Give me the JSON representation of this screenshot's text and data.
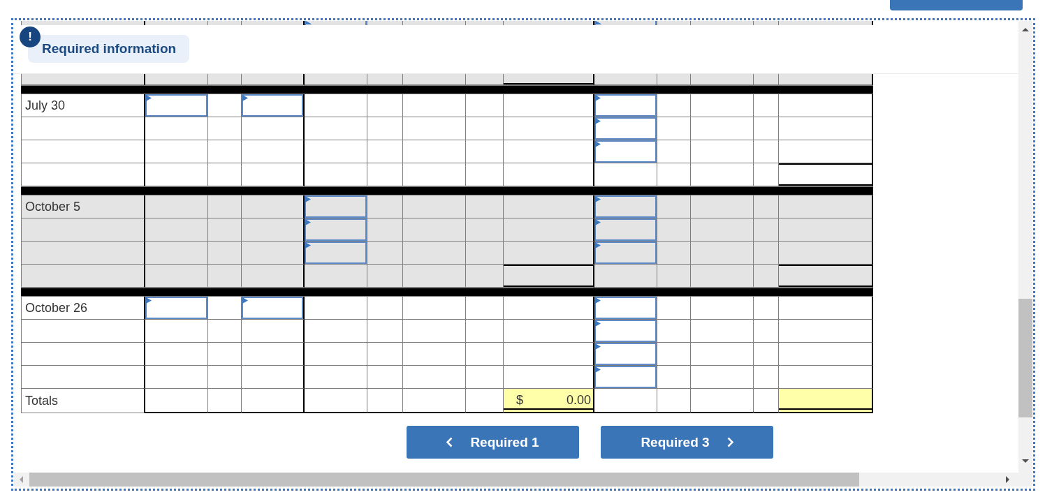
{
  "cut_row": {
    "shaded": true,
    "cells": [
      {
        "kind": "blank"
      },
      {
        "kind": "blank"
      },
      {
        "kind": "blank"
      },
      {
        "kind": "input"
      },
      {
        "kind": "blank"
      },
      {
        "kind": "blank"
      },
      {
        "kind": "blank"
      },
      {
        "kind": "blank"
      },
      {
        "kind": "input"
      },
      {
        "kind": "blank"
      },
      {
        "kind": "blank"
      },
      {
        "kind": "blank"
      },
      {
        "kind": "blank"
      }
    ]
  },
  "notice": {
    "icon": "!",
    "label": "Required information"
  },
  "table": {
    "sections": [
      {
        "shaded": true,
        "clipped": true,
        "rows": [
          {
            "cells": [
              {
                "kind": "blank"
              },
              {
                "kind": "blank"
              },
              {
                "kind": "blank"
              },
              {
                "kind": "blank"
              },
              {
                "kind": "blank"
              },
              {
                "kind": "blank"
              },
              {
                "kind": "blank"
              },
              {
                "kind": "rule"
              },
              {
                "kind": "blank"
              },
              {
                "kind": "blank"
              },
              {
                "kind": "blank"
              },
              {
                "kind": "blank"
              },
              {
                "kind": "blank"
              }
            ]
          }
        ]
      },
      {
        "shaded": false,
        "clipped": false,
        "rows": [
          {
            "label": "July 30",
            "cells": [
              {
                "kind": "input"
              },
              {
                "kind": "blank"
              },
              {
                "kind": "input"
              },
              {
                "kind": "blank"
              },
              {
                "kind": "blank"
              },
              {
                "kind": "blank"
              },
              {
                "kind": "blank"
              },
              {
                "kind": "blank"
              },
              {
                "kind": "input"
              },
              {
                "kind": "blank"
              },
              {
                "kind": "blank"
              },
              {
                "kind": "blank"
              },
              {
                "kind": "blank"
              }
            ]
          },
          {
            "cells": [
              {
                "kind": "blank"
              },
              {
                "kind": "blank"
              },
              {
                "kind": "blank"
              },
              {
                "kind": "blank"
              },
              {
                "kind": "blank"
              },
              {
                "kind": "blank"
              },
              {
                "kind": "blank"
              },
              {
                "kind": "blank"
              },
              {
                "kind": "input"
              },
              {
                "kind": "blank"
              },
              {
                "kind": "blank"
              },
              {
                "kind": "blank"
              },
              {
                "kind": "blank"
              }
            ]
          },
          {
            "cells": [
              {
                "kind": "blank"
              },
              {
                "kind": "blank"
              },
              {
                "kind": "blank"
              },
              {
                "kind": "blank"
              },
              {
                "kind": "blank"
              },
              {
                "kind": "blank"
              },
              {
                "kind": "blank"
              },
              {
                "kind": "blank"
              },
              {
                "kind": "input"
              },
              {
                "kind": "blank"
              },
              {
                "kind": "blank"
              },
              {
                "kind": "blank"
              },
              {
                "kind": "blank"
              }
            ]
          },
          {
            "cells": [
              {
                "kind": "blank"
              },
              {
                "kind": "blank"
              },
              {
                "kind": "blank"
              },
              {
                "kind": "blank"
              },
              {
                "kind": "blank"
              },
              {
                "kind": "blank"
              },
              {
                "kind": "blank"
              },
              {
                "kind": "blank"
              },
              {
                "kind": "blank"
              },
              {
                "kind": "blank"
              },
              {
                "kind": "blank"
              },
              {
                "kind": "blank"
              },
              {
                "kind": "rule"
              }
            ]
          }
        ]
      },
      {
        "shaded": true,
        "clipped": false,
        "rows": [
          {
            "label": "October 5",
            "cells": [
              {
                "kind": "blank"
              },
              {
                "kind": "blank"
              },
              {
                "kind": "blank"
              },
              {
                "kind": "input"
              },
              {
                "kind": "blank"
              },
              {
                "kind": "blank"
              },
              {
                "kind": "blank"
              },
              {
                "kind": "blank"
              },
              {
                "kind": "input"
              },
              {
                "kind": "blank"
              },
              {
                "kind": "blank"
              },
              {
                "kind": "blank"
              },
              {
                "kind": "blank"
              }
            ]
          },
          {
            "cells": [
              {
                "kind": "blank"
              },
              {
                "kind": "blank"
              },
              {
                "kind": "blank"
              },
              {
                "kind": "input"
              },
              {
                "kind": "blank"
              },
              {
                "kind": "blank"
              },
              {
                "kind": "blank"
              },
              {
                "kind": "blank"
              },
              {
                "kind": "input"
              },
              {
                "kind": "blank"
              },
              {
                "kind": "blank"
              },
              {
                "kind": "blank"
              },
              {
                "kind": "blank"
              }
            ]
          },
          {
            "cells": [
              {
                "kind": "blank"
              },
              {
                "kind": "blank"
              },
              {
                "kind": "blank"
              },
              {
                "kind": "input"
              },
              {
                "kind": "blank"
              },
              {
                "kind": "blank"
              },
              {
                "kind": "blank"
              },
              {
                "kind": "blank"
              },
              {
                "kind": "input"
              },
              {
                "kind": "blank"
              },
              {
                "kind": "blank"
              },
              {
                "kind": "blank"
              },
              {
                "kind": "blank"
              }
            ]
          },
          {
            "cells": [
              {
                "kind": "blank"
              },
              {
                "kind": "blank"
              },
              {
                "kind": "blank"
              },
              {
                "kind": "blank"
              },
              {
                "kind": "blank"
              },
              {
                "kind": "blank"
              },
              {
                "kind": "blank"
              },
              {
                "kind": "rule"
              },
              {
                "kind": "blank"
              },
              {
                "kind": "blank"
              },
              {
                "kind": "blank"
              },
              {
                "kind": "blank"
              },
              {
                "kind": "rule"
              }
            ]
          }
        ]
      },
      {
        "shaded": false,
        "clipped": false,
        "rows": [
          {
            "label": "October 26",
            "cells": [
              {
                "kind": "input"
              },
              {
                "kind": "blank"
              },
              {
                "kind": "input"
              },
              {
                "kind": "blank"
              },
              {
                "kind": "blank"
              },
              {
                "kind": "blank"
              },
              {
                "kind": "blank"
              },
              {
                "kind": "blank"
              },
              {
                "kind": "input"
              },
              {
                "kind": "blank"
              },
              {
                "kind": "blank"
              },
              {
                "kind": "blank"
              },
              {
                "kind": "blank"
              }
            ]
          },
          {
            "cells": [
              {
                "kind": "blank"
              },
              {
                "kind": "blank"
              },
              {
                "kind": "blank"
              },
              {
                "kind": "blank"
              },
              {
                "kind": "blank"
              },
              {
                "kind": "blank"
              },
              {
                "kind": "blank"
              },
              {
                "kind": "blank"
              },
              {
                "kind": "input"
              },
              {
                "kind": "blank"
              },
              {
                "kind": "blank"
              },
              {
                "kind": "blank"
              },
              {
                "kind": "blank"
              }
            ]
          },
          {
            "cells": [
              {
                "kind": "blank"
              },
              {
                "kind": "blank"
              },
              {
                "kind": "blank"
              },
              {
                "kind": "blank"
              },
              {
                "kind": "blank"
              },
              {
                "kind": "blank"
              },
              {
                "kind": "blank"
              },
              {
                "kind": "blank"
              },
              {
                "kind": "input"
              },
              {
                "kind": "blank"
              },
              {
                "kind": "blank"
              },
              {
                "kind": "blank"
              },
              {
                "kind": "blank"
              }
            ]
          },
          {
            "cells": [
              {
                "kind": "blank"
              },
              {
                "kind": "blank"
              },
              {
                "kind": "blank"
              },
              {
                "kind": "blank"
              },
              {
                "kind": "blank"
              },
              {
                "kind": "blank"
              },
              {
                "kind": "blank"
              },
              {
                "kind": "blank"
              },
              {
                "kind": "input"
              },
              {
                "kind": "blank"
              },
              {
                "kind": "blank"
              },
              {
                "kind": "blank"
              },
              {
                "kind": "blank"
              }
            ]
          }
        ]
      }
    ],
    "totals": {
      "label": "Totals",
      "cells": [
        {
          "kind": "blank"
        },
        {
          "kind": "blank"
        },
        {
          "kind": "blank"
        },
        {
          "kind": "blank"
        },
        {
          "kind": "blank"
        },
        {
          "kind": "blank"
        },
        {
          "kind": "blank"
        },
        {
          "kind": "total",
          "currency": "$",
          "value": "0.00"
        },
        {
          "kind": "blank"
        },
        {
          "kind": "blank"
        },
        {
          "kind": "blank"
        },
        {
          "kind": "blank"
        },
        {
          "kind": "total"
        }
      ]
    }
  },
  "buttons": [
    {
      "label": "Required 1",
      "kind": "previous"
    },
    {
      "label": "Required 3",
      "kind": "next"
    }
  ]
}
